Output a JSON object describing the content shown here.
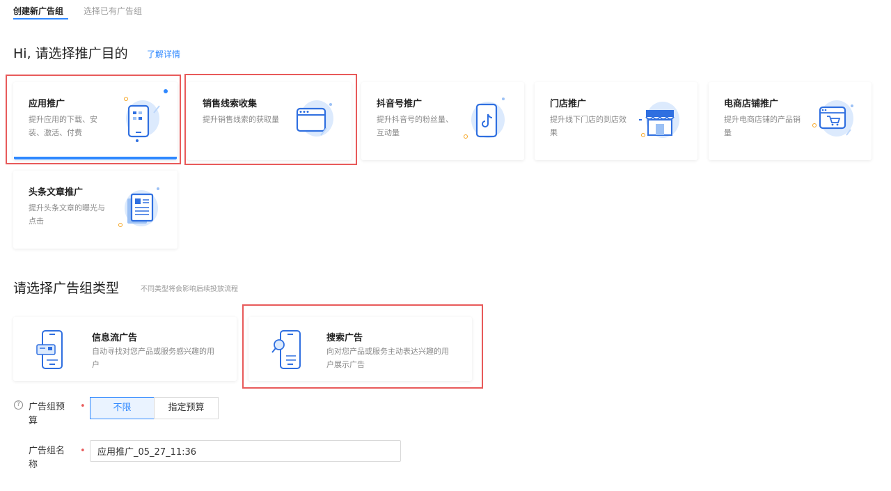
{
  "tabs": [
    {
      "label": "创建新广告组",
      "active": true
    },
    {
      "label": "选择已有广告组",
      "active": false
    }
  ],
  "purpose": {
    "title": "Hi, 请选择推广目的",
    "learn_more": "了解详情",
    "cards": [
      {
        "title": "应用推广",
        "desc": "提升应用的下载、安装、激活、付费",
        "icon": "app-phone-icon",
        "selected": true
      },
      {
        "title": "销售线索收集",
        "desc": "提升销售线索的获取量",
        "icon": "browser-window-icon",
        "selected": false
      },
      {
        "title": "抖音号推广",
        "desc": "提升抖音号的粉丝量、互动量",
        "icon": "tiktok-phone-icon",
        "selected": false
      },
      {
        "title": "门店推广",
        "desc": "提升线下门店的到店效果",
        "icon": "storefront-icon",
        "selected": false
      },
      {
        "title": "电商店铺推广",
        "desc": "提升电商店铺的产品销量",
        "icon": "shopping-cart-window-icon",
        "selected": false
      },
      {
        "title": "头条文章推广",
        "desc": "提升头条文章的曝光与点击",
        "icon": "article-icon",
        "selected": false
      }
    ]
  },
  "group_type": {
    "title": "请选择广告组类型",
    "hint": "不同类型将会影响后续投放流程",
    "cards": [
      {
        "title": "信息流广告",
        "desc": "自动寻找对您产品或服务感兴趣的用户",
        "icon": "feed-phone-icon"
      },
      {
        "title": "搜索广告",
        "desc": "向对您产品或服务主动表达兴趣的用户展示广告",
        "icon": "search-phone-icon"
      }
    ]
  },
  "budget": {
    "label": "广告组预算",
    "help": "?",
    "required_mark": "•",
    "options": [
      "不限",
      "指定预算"
    ],
    "selected": "不限"
  },
  "name_field": {
    "label": "广告组名称",
    "required_mark": "•",
    "value": "应用推广_05_27_11:36"
  },
  "colors": {
    "accent": "#2f88ff",
    "highlight_box": "#e85a5a"
  }
}
